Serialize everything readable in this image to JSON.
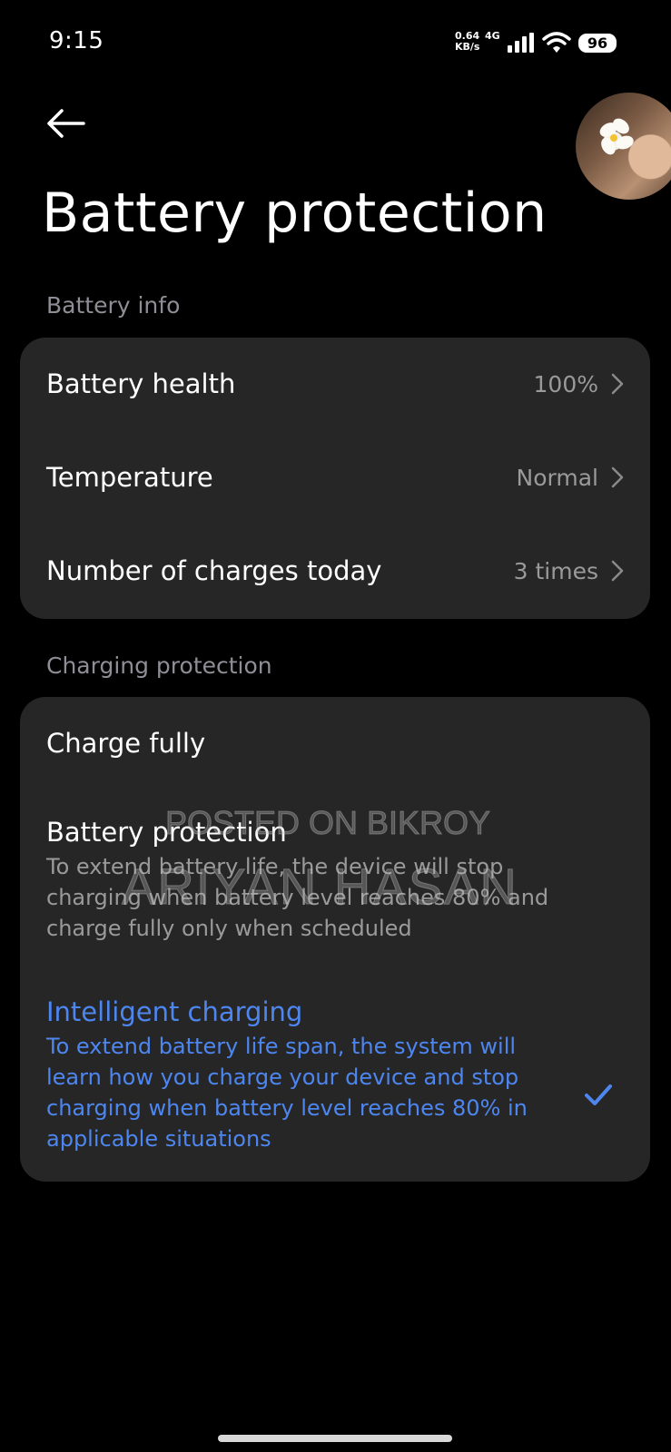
{
  "status_bar": {
    "time": "9:15",
    "net_speed_value": "0.64",
    "net_speed_unit": "KB/s",
    "network_type": "4G",
    "signal_icon": "signal-bars-icon",
    "wifi_icon": "wifi-icon",
    "battery_level": "96"
  },
  "header": {
    "back_icon": "arrow-left-icon",
    "title": "Battery protection"
  },
  "battery_info": {
    "section_label": "Battery info",
    "rows": [
      {
        "label": "Battery health",
        "value": "100%"
      },
      {
        "label": "Temperature",
        "value": "Normal"
      },
      {
        "label": "Number of charges today",
        "value": "3 times"
      }
    ]
  },
  "charging_protection": {
    "section_label": "Charging protection",
    "options": [
      {
        "title": "Charge fully",
        "description": "",
        "selected": false
      },
      {
        "title": "Battery protection",
        "description": "To extend battery life, the device will stop charging when battery level reaches 80% and charge fully only when scheduled",
        "selected": false
      },
      {
        "title": "Intelligent charging",
        "description": "To extend battery life span, the system will learn how you charge your device and stop charging when battery level reaches 80% in applicable situations",
        "selected": true
      }
    ]
  },
  "watermark": {
    "line1": "POSTED ON BIKROY",
    "line2": "ARIYAN HASAN"
  },
  "colors": {
    "background": "#000000",
    "card": "#262626",
    "accent": "#4e86f0",
    "secondary_text": "#9a9a9a",
    "section_label": "#8e8e96"
  }
}
